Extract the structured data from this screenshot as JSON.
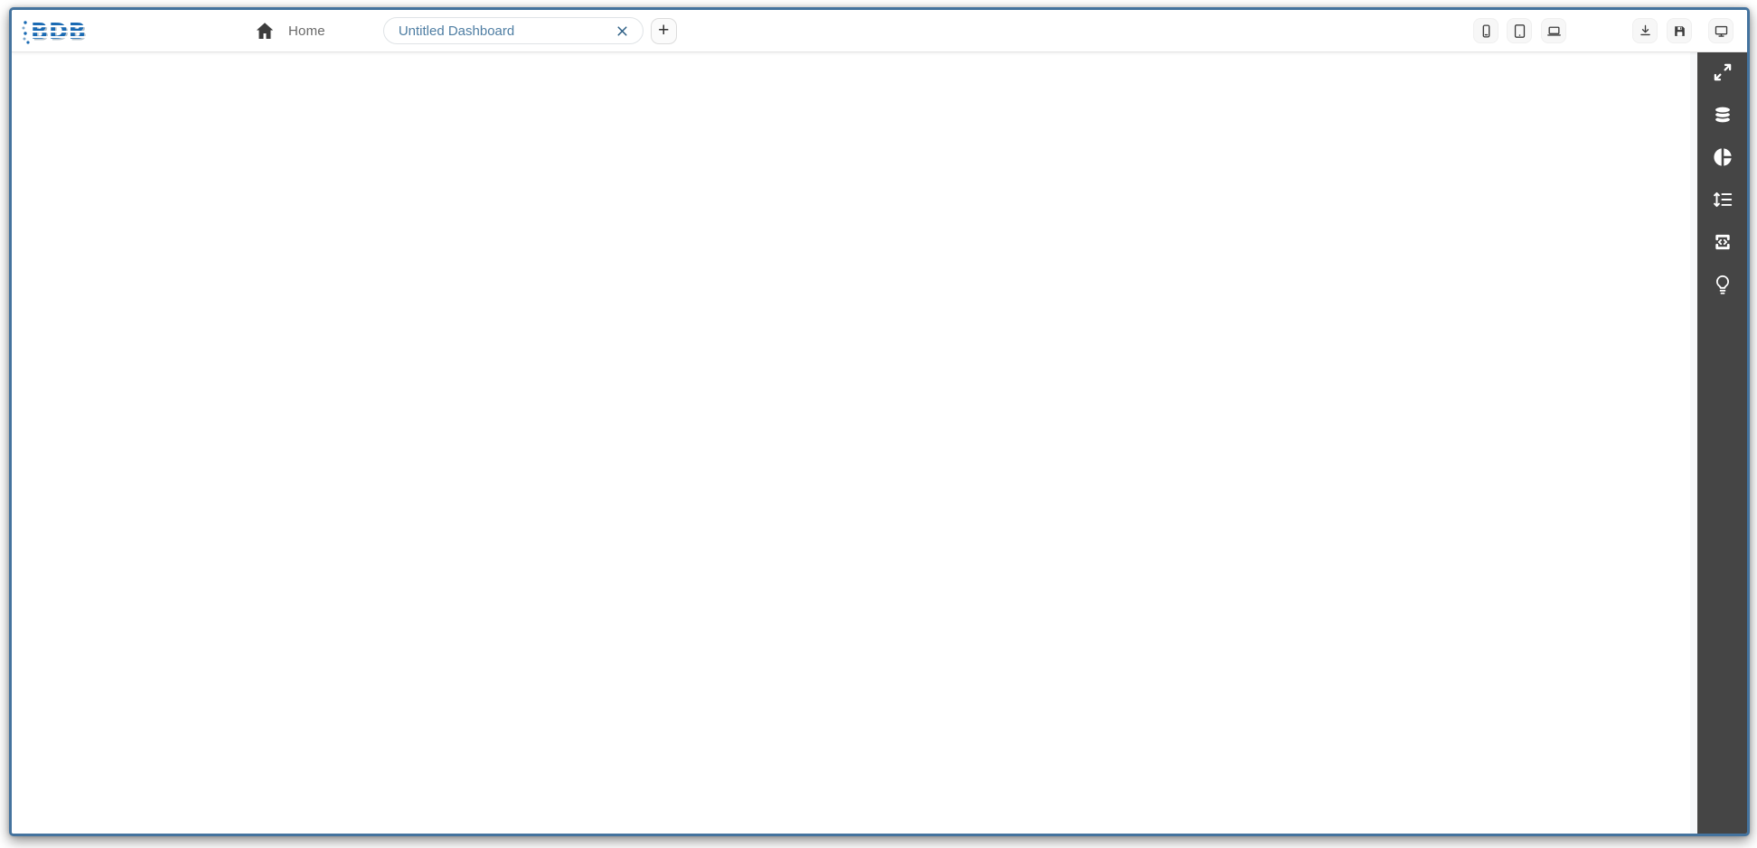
{
  "app": {
    "logo_text": "BDB",
    "colors": {
      "window_border": "#44739e",
      "toolbar_background": "#454545",
      "tab_text": "#4f7ea3",
      "logo_blue": "#1a6ab3"
    }
  },
  "header": {
    "home_label": "Home",
    "tab": {
      "title": "Untitled Dashboard",
      "close_icon": "close-icon"
    },
    "add_tab_label": "+",
    "preview_buttons": [
      {
        "name": "mobile-preview",
        "icon": "mobile-icon"
      },
      {
        "name": "tablet-preview",
        "icon": "tablet-icon"
      },
      {
        "name": "laptop-preview",
        "icon": "laptop-icon"
      }
    ],
    "action_buttons": [
      {
        "name": "export",
        "icon": "download-icon"
      },
      {
        "name": "save",
        "icon": "save-icon"
      },
      {
        "name": "preview-desktop",
        "icon": "monitor-icon"
      }
    ]
  },
  "toolbar": {
    "items": [
      {
        "name": "expand",
        "icon": "expand-icon"
      },
      {
        "name": "data-sources",
        "icon": "database-icon"
      },
      {
        "name": "charts",
        "icon": "pie-chart-icon"
      },
      {
        "name": "component-list",
        "icon": "line-spacing-icon"
      },
      {
        "name": "script",
        "icon": "code-icon"
      },
      {
        "name": "insights",
        "icon": "lightbulb-icon"
      }
    ]
  },
  "canvas": {
    "content": ""
  }
}
